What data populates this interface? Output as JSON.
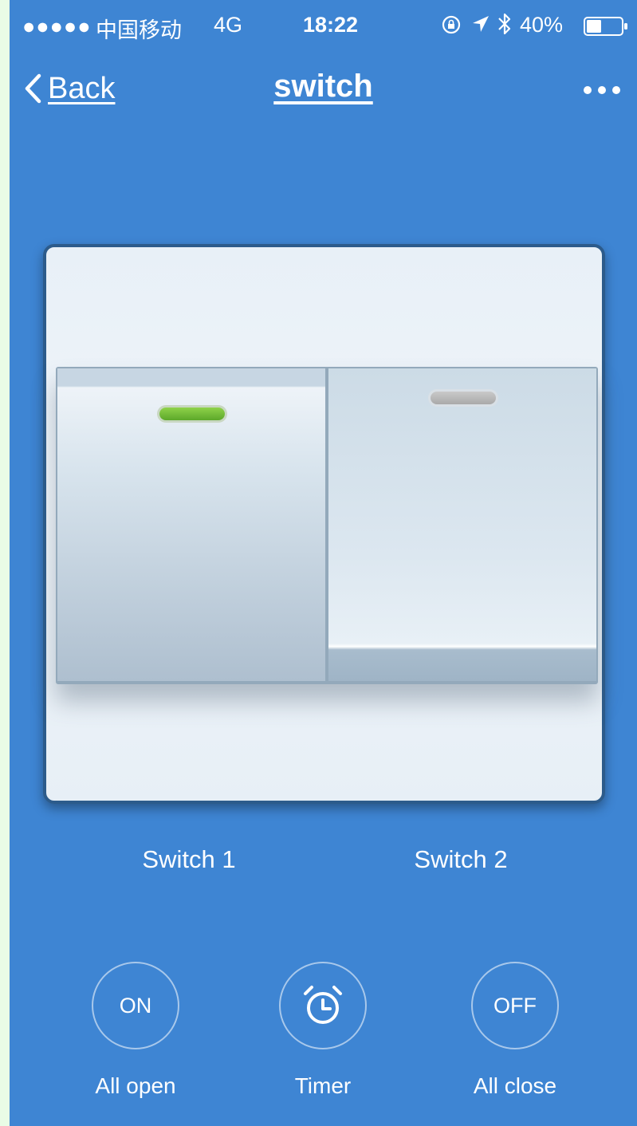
{
  "status_bar": {
    "signal": "●●●●●",
    "carrier": "中国移动",
    "network": "4G",
    "time": "18:22",
    "battery": "40%"
  },
  "nav": {
    "back_label": "Back",
    "title": "switch"
  },
  "switches": [
    {
      "label": "Switch 1",
      "state": "on",
      "indicator_color": "#6ebf33"
    },
    {
      "label": "Switch 2",
      "state": "off",
      "indicator_color": "#b8b8b8"
    }
  ],
  "actions": {
    "all_open": {
      "button_text": "ON",
      "label": "All open"
    },
    "timer": {
      "icon": "alarm-clock-icon",
      "label": "Timer"
    },
    "all_close": {
      "button_text": "OFF",
      "label": "All close"
    }
  },
  "colors": {
    "background": "#3e85d3",
    "on_indicator": "#6ebf33",
    "off_indicator": "#b8b8b8"
  }
}
